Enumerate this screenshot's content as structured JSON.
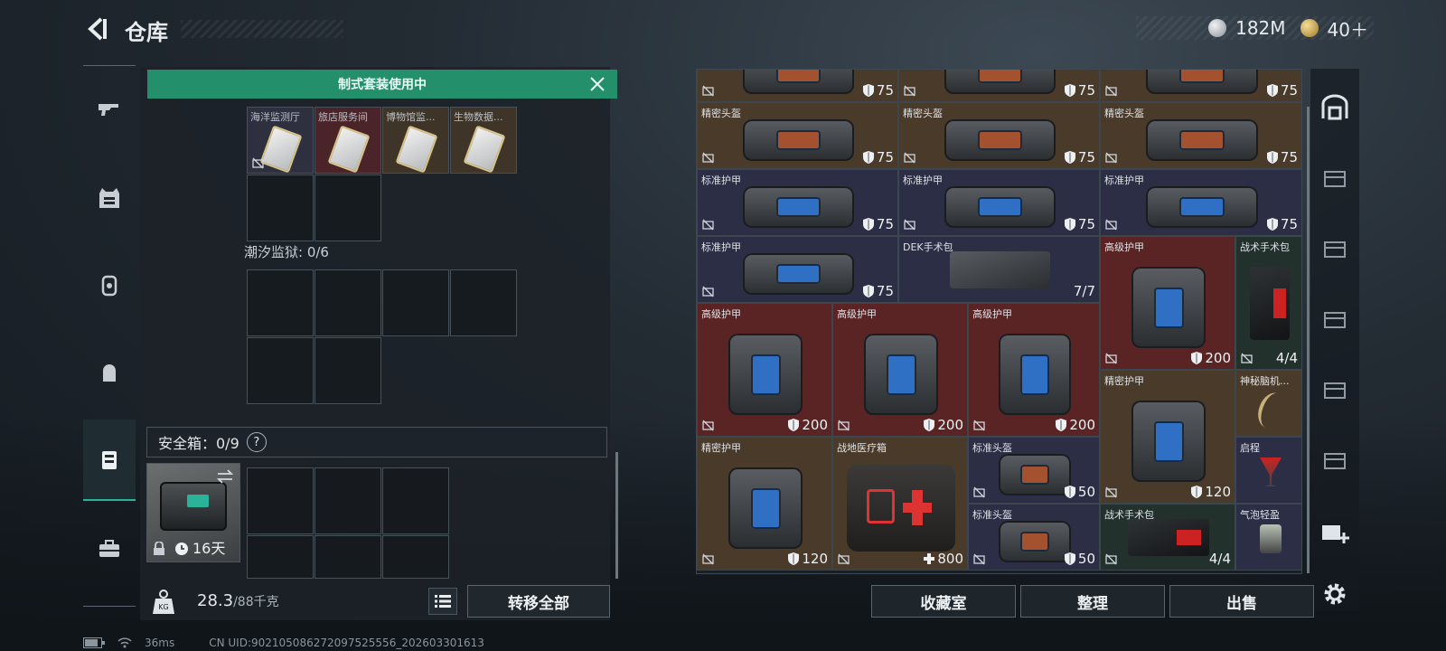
{
  "header": {
    "title": "仓库",
    "currency": [
      {
        "icon": "silver-coin-icon",
        "value": "182M"
      },
      {
        "icon": "gold-coin-icon",
        "value": "40＋"
      }
    ]
  },
  "left": {
    "banner": "制式套装使用中",
    "cards": [
      "海洋监测厅",
      "旅店服务间",
      "博物馆监...",
      "生物数据..."
    ],
    "prison_label": "潮汐监狱: 0/6",
    "safe_label": "安全箱：0/9",
    "safe_help": "?",
    "safe_days": "16天",
    "weight": "28.3",
    "weight_max": "/88千克",
    "transfer_all": "转移全部"
  },
  "grid_items": [
    {
      "name": "",
      "value": "75",
      "kind": "helmet"
    },
    {
      "name": "",
      "value": "75",
      "kind": "helmet"
    },
    {
      "name": "",
      "value": "75",
      "kind": "helmet"
    },
    {
      "name": "精密头盔",
      "value": "75",
      "kind": "helmet"
    },
    {
      "name": "精密头盔",
      "value": "75",
      "kind": "helmet"
    },
    {
      "name": "精密头盔",
      "value": "75",
      "kind": "helmet"
    },
    {
      "name": "标准护甲",
      "value": "75",
      "kind": "armor"
    },
    {
      "name": "标准护甲",
      "value": "75",
      "kind": "armor"
    },
    {
      "name": "标准护甲",
      "value": "75",
      "kind": "armor"
    },
    {
      "name": "标准护甲",
      "value": "75",
      "kind": "armor"
    },
    {
      "name": "DEK手术包",
      "value": "7/7",
      "kind": "surgical"
    },
    {
      "name": "高级护甲",
      "value": "200",
      "kind": "armor"
    },
    {
      "name": "战术手术包",
      "value": "4/4",
      "kind": "tactical"
    },
    {
      "name": "高级护甲",
      "value": "200",
      "kind": "armor"
    },
    {
      "name": "高级护甲",
      "value": "200",
      "kind": "armor"
    },
    {
      "name": "高级护甲",
      "value": "200",
      "kind": "armor"
    },
    {
      "name": "精密护甲",
      "value": "120",
      "kind": "armor"
    },
    {
      "name": "神秘脑机...",
      "value": "",
      "kind": "device"
    },
    {
      "name": "精密护甲",
      "value": "120",
      "kind": "armor"
    },
    {
      "name": "战地医疗箱",
      "value": "800",
      "kind": "medkit"
    },
    {
      "name": "标准头盔",
      "value": "50",
      "kind": "helmet"
    },
    {
      "name": "启程",
      "value": "",
      "kind": "drink"
    },
    {
      "name": "标准头盔",
      "value": "50",
      "kind": "helmet"
    },
    {
      "name": "战术手术包",
      "value": "4/4",
      "kind": "tactical"
    },
    {
      "name": "气泡轻盈",
      "value": "",
      "kind": "drink"
    }
  ],
  "bottom": {
    "collection": "收藏室",
    "organize": "整理",
    "sell": "出售"
  },
  "status": {
    "ping": "36ms",
    "uid": "CN UID:902105086272097525556_202603301613"
  },
  "colors": {
    "brown": "#4a3a2a",
    "navy": "#2b2e45",
    "red": "#5a2424",
    "green": "#23906b"
  }
}
